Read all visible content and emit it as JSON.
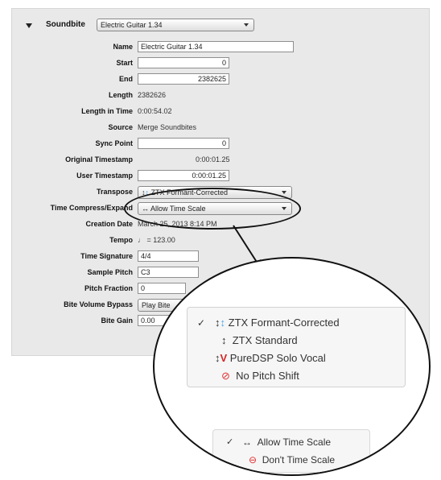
{
  "soundbite": {
    "label": "Soundbite",
    "selected": "Electric Guitar 1.34"
  },
  "rows": [
    {
      "label": "Name",
      "value": "Electric Guitar 1.34"
    },
    {
      "label": "Start",
      "value": "0"
    },
    {
      "label": "End",
      "value": "2382625"
    },
    {
      "label": "Length",
      "value": "2382626"
    },
    {
      "label": "Length in Time",
      "value": "0:00:54.02"
    },
    {
      "label": "Source",
      "value": "Merge Soundbites"
    },
    {
      "label": "Sync Point",
      "value": "0"
    },
    {
      "label": "Original Timestamp",
      "value": "0:00:01.25"
    },
    {
      "label": "User Timestamp",
      "value": "0:00:01.25"
    },
    {
      "label": "Transpose",
      "value": "ZTX Formant-Corrected"
    },
    {
      "label": "Time Compress/Expand",
      "value": "Allow Time Scale"
    },
    {
      "label": "Creation Date",
      "value": "March 25, 2013 8:14 PM"
    },
    {
      "label": "Tempo",
      "value": "= 123.00"
    },
    {
      "label": "Time Signature",
      "value": "4/4"
    },
    {
      "label": "Sample Pitch",
      "value": "C3"
    },
    {
      "label": "Pitch Fraction",
      "value": "0"
    },
    {
      "label": "Bite Volume Bypass",
      "value": "Play Bite"
    },
    {
      "label": "Bite Gain",
      "value": "0.00"
    }
  ],
  "transpose_menu": {
    "items": [
      {
        "label": "ZTX Formant-Corrected",
        "checked": "✓"
      },
      {
        "label": "ZTX Standard"
      },
      {
        "label": "PureDSP Solo Vocal"
      },
      {
        "label": "No Pitch Shift"
      }
    ]
  },
  "time_menu": {
    "items": [
      {
        "label": "Allow Time Scale",
        "checked": "✓"
      },
      {
        "label": "Don't Time Scale"
      }
    ]
  },
  "icons": {
    "up_down_arrow": "↕",
    "left_right_arrow": "↔",
    "quarter_note": "♩",
    "v_letter": "V",
    "no_pitch_symbol": "⊘",
    "no_scale_symbol": "⊖"
  },
  "colors": {
    "panel_bg": "#e9e9e9",
    "icon_blue": "#4fa6e8",
    "icon_red": "#d42525"
  }
}
